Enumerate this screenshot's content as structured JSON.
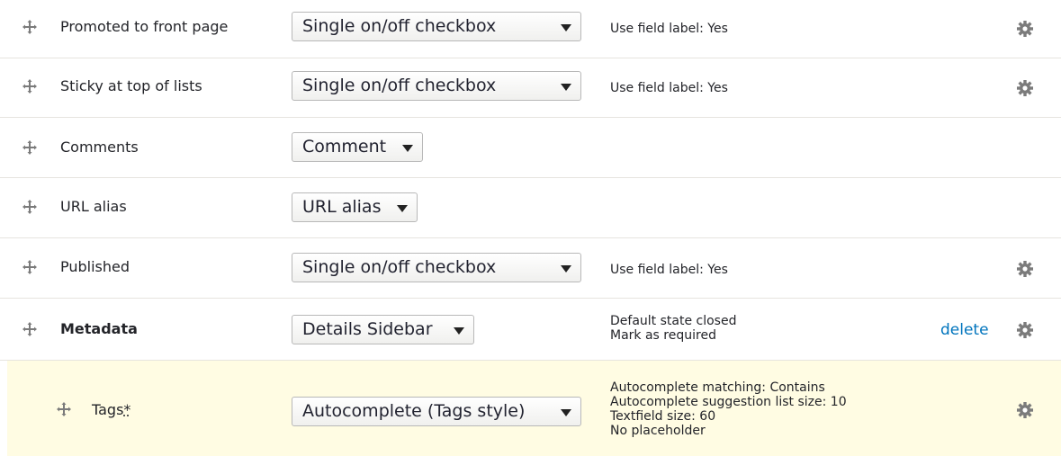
{
  "colors": {
    "highlight_row": "#fffce3",
    "link": "#0074bd",
    "border": "#e6e4df",
    "icon": "#7b7b7b"
  },
  "rows": [
    {
      "label": "Promoted to front page",
      "widget": "Single on/off checkbox",
      "summary": [
        "Use field label: Yes"
      ],
      "has_gear": true
    },
    {
      "label": "Sticky at top of lists",
      "widget": "Single on/off checkbox",
      "summary": [
        "Use field label: Yes"
      ],
      "has_gear": true
    },
    {
      "label": "Comments",
      "widget": "Comment",
      "summary": [],
      "has_gear": false
    },
    {
      "label": "URL alias",
      "widget": "URL alias",
      "summary": [],
      "has_gear": false
    },
    {
      "label": "Published",
      "widget": "Single on/off checkbox",
      "summary": [
        "Use field label: Yes"
      ],
      "has_gear": true
    },
    {
      "label": "Metadata",
      "widget": "Details Sidebar",
      "summary": [
        "Default state closed",
        "Mark as required"
      ],
      "delete_label": "delete",
      "has_gear": true
    },
    {
      "label": "Tags",
      "required_marker": "*",
      "widget": "Autocomplete (Tags style)",
      "summary": [
        "Autocomplete matching: Contains",
        "Autocomplete suggestion list size: 10",
        "Textfield size: 60",
        "No placeholder"
      ],
      "has_gear": true
    }
  ]
}
